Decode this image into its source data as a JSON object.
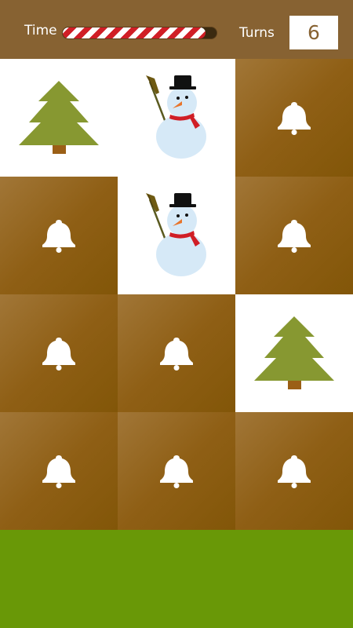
{
  "header": {
    "time_label": "Time",
    "time_remaining_fraction": 0.93,
    "turns_label": "Turns",
    "turns_value": "6"
  },
  "colors": {
    "header_bg": "#876232",
    "card_back": "#8f5f15",
    "card_face": "#ffffff",
    "ground": "#699807",
    "tree": "#879831",
    "trunk": "#9b5f16",
    "bell": "#ffffff"
  },
  "board": {
    "rows": 4,
    "cols": 3,
    "cards": [
      {
        "state": "revealed",
        "symbol": "christmas-tree"
      },
      {
        "state": "revealed",
        "symbol": "snowman"
      },
      {
        "state": "hidden",
        "symbol": "bell"
      },
      {
        "state": "hidden",
        "symbol": "bell"
      },
      {
        "state": "revealed",
        "symbol": "snowman"
      },
      {
        "state": "hidden",
        "symbol": "bell"
      },
      {
        "state": "hidden",
        "symbol": "bell"
      },
      {
        "state": "hidden",
        "symbol": "bell"
      },
      {
        "state": "revealed",
        "symbol": "christmas-tree"
      },
      {
        "state": "hidden",
        "symbol": "bell"
      },
      {
        "state": "hidden",
        "symbol": "bell"
      },
      {
        "state": "hidden",
        "symbol": "bell"
      }
    ]
  }
}
